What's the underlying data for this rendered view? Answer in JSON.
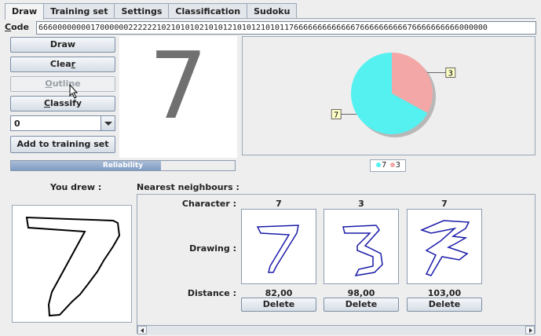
{
  "tabs": [
    {
      "label": "Draw",
      "active": true
    },
    {
      "label": "Training set",
      "active": false
    },
    {
      "label": "Settings",
      "active": false
    },
    {
      "label": "Classification",
      "active": false
    },
    {
      "label": "Sudoku",
      "active": false
    }
  ],
  "code": {
    "label_prefix": "C",
    "label_rest": "ode",
    "value": "66600000000170000002222221021010102101012101012101011766666666666667666666666676666666666000000"
  },
  "buttons": {
    "draw": "Draw",
    "clear_pre": "Clea",
    "clear_ul": "r",
    "outline_pre": "",
    "outline_ul": "O",
    "outline_post": "utline",
    "classify_pre": "",
    "classify_ul": "C",
    "classify_post": "lassify",
    "add": "Add to training set"
  },
  "combo": {
    "value": "0"
  },
  "recognized": {
    "digit": "7"
  },
  "reliability": {
    "label": "Reliability",
    "fraction": 0.67
  },
  "pie": {
    "slices": [
      {
        "label": "7",
        "value": 67,
        "color": "#55f0f0"
      },
      {
        "label": "3",
        "value": 33,
        "color": "#f4a7a7"
      }
    ],
    "legend": [
      {
        "label": "7",
        "color": "#55f0f0"
      },
      {
        "label": "3",
        "color": "#f4a7a7"
      }
    ]
  },
  "you_drew": "You drew :",
  "nearest": {
    "title": "Nearest neighbours :",
    "row_character": "Character :",
    "row_drawing": "Drawing :",
    "row_distance": "Distance :",
    "delete_label": "Delete",
    "items": [
      {
        "character": "7",
        "distance": "82,00"
      },
      {
        "character": "3",
        "distance": "98,00"
      },
      {
        "character": "7",
        "distance": "103,00"
      }
    ]
  },
  "colors": {
    "stroke_user": "#000000",
    "stroke_neighbour": "#1a1aa8"
  }
}
